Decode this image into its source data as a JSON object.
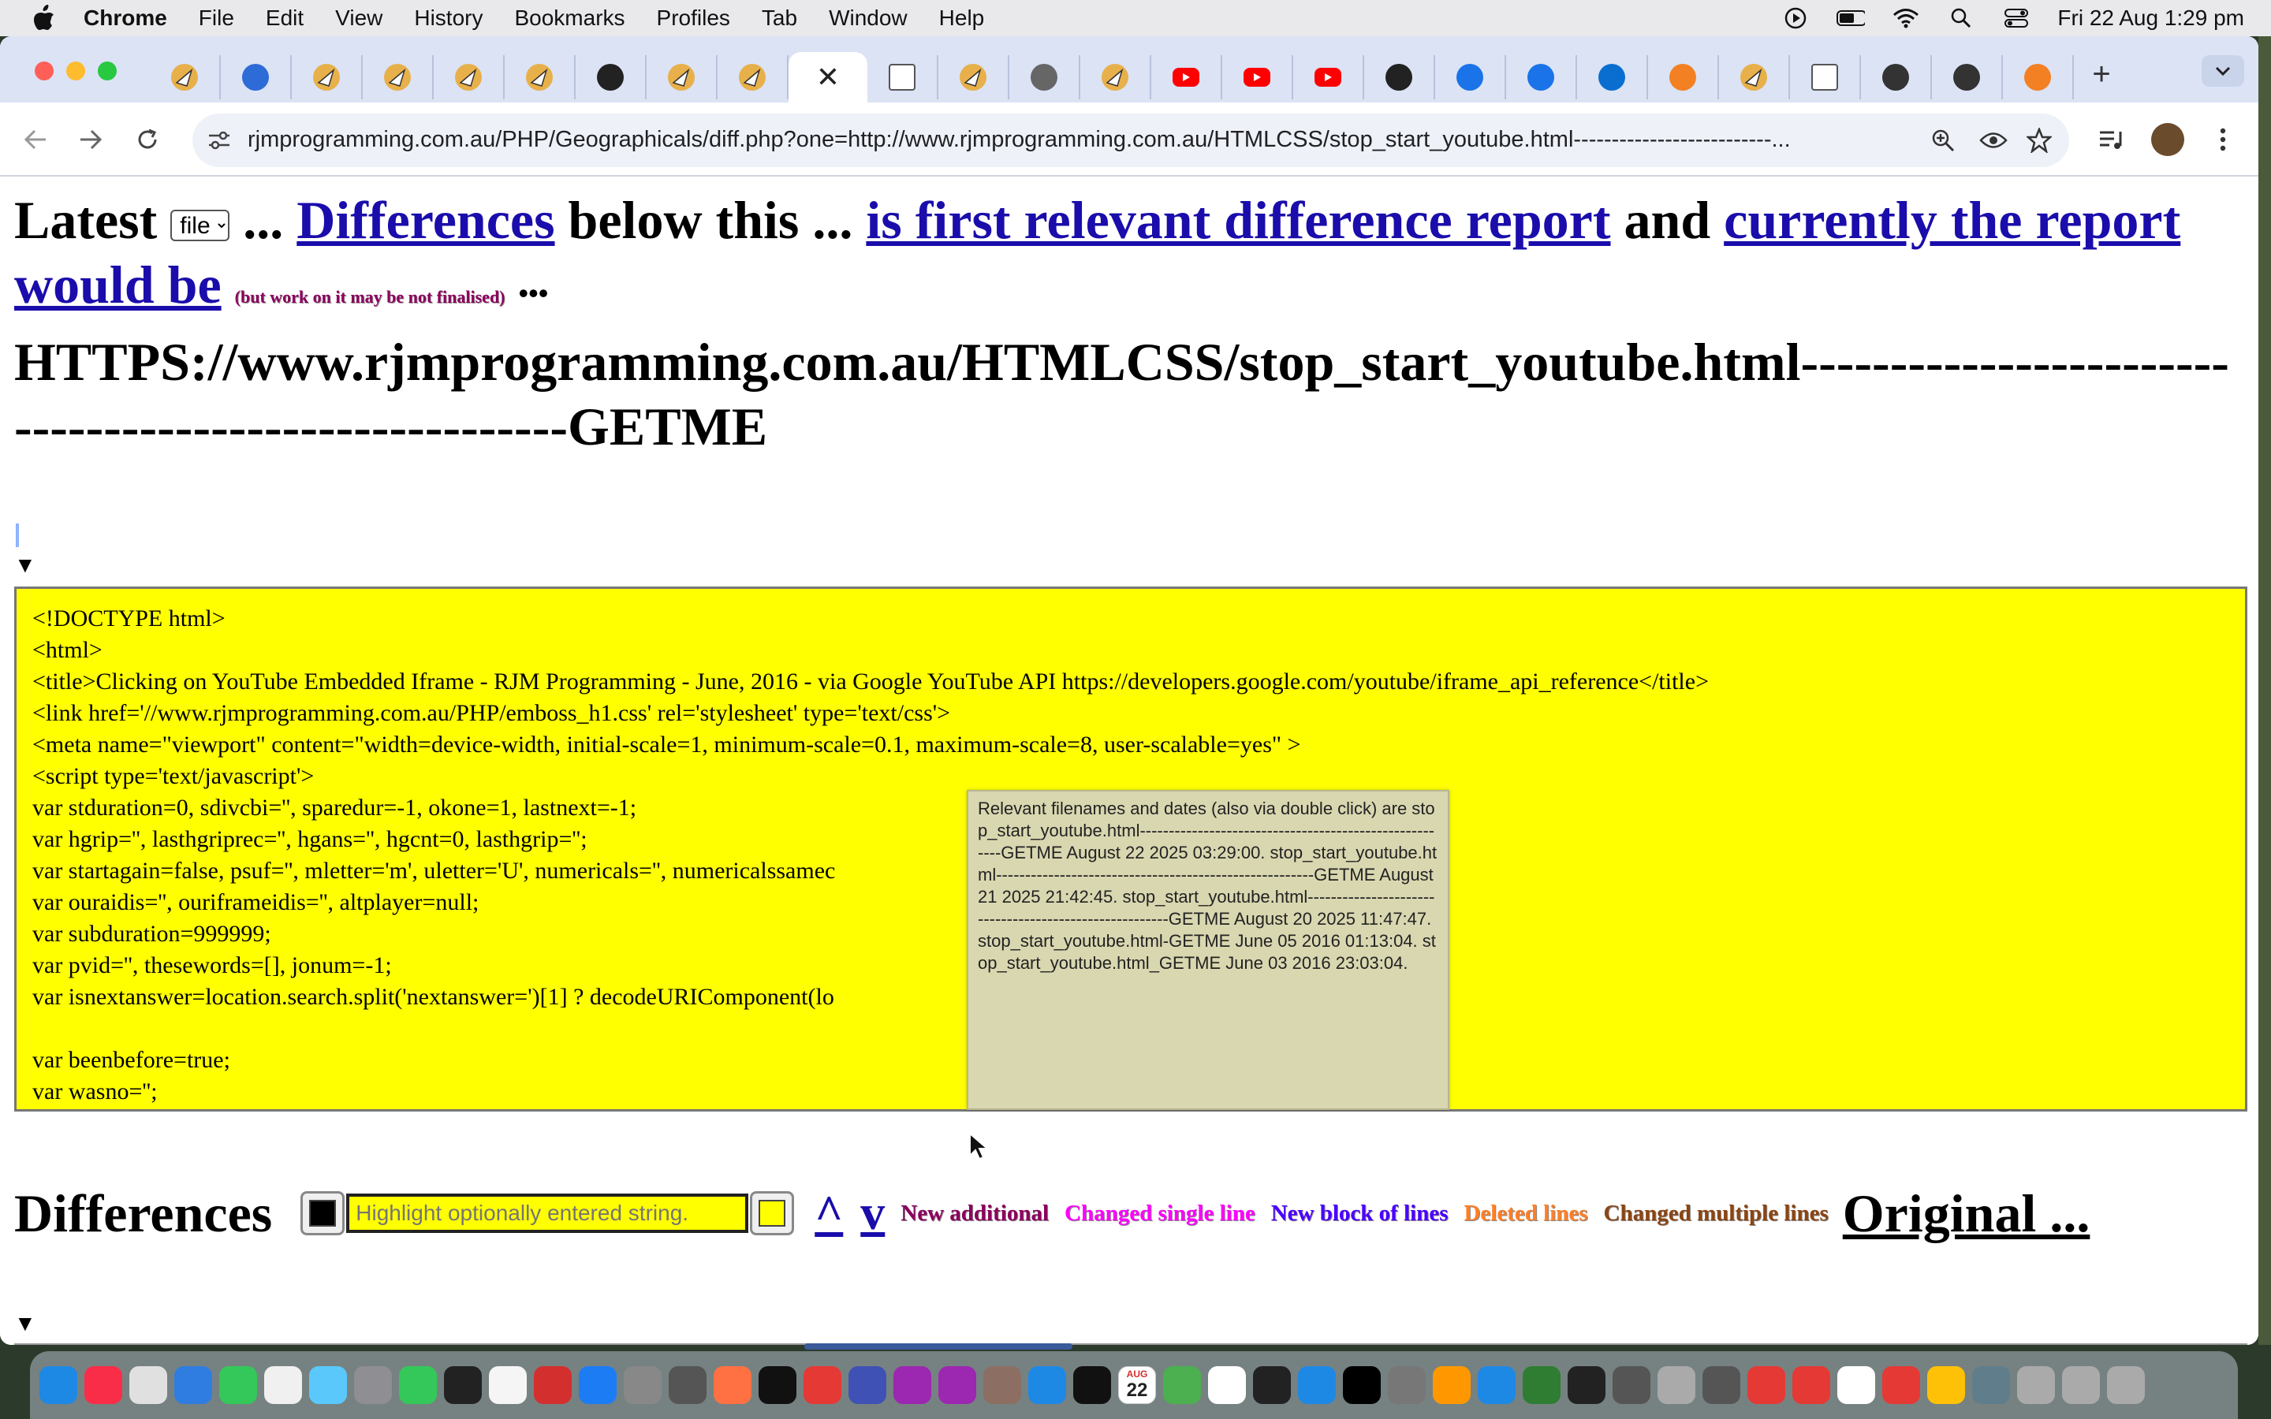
{
  "menubar": {
    "app": "Chrome",
    "items": [
      "File",
      "Edit",
      "View",
      "History",
      "Bookmarks",
      "Profiles",
      "Tab",
      "Window",
      "Help"
    ],
    "clock": "Fri 22 Aug  1:29 pm"
  },
  "tabs": {
    "count_icons": [
      "rjm",
      "check",
      "rjm",
      "rjm",
      "rjm",
      "rjm",
      "circle",
      "rjm",
      "rjm",
      "active",
      "page",
      "rjm",
      "globe",
      "rjm",
      "youtube",
      "youtube",
      "youtube",
      "s",
      "history",
      "gear",
      "sap",
      "stack",
      "rjm",
      "google",
      "github",
      "github",
      "stack"
    ],
    "active_close": "✕",
    "new_tab": "+"
  },
  "address_bar": {
    "url": "rjmprogramming.com.au/PHP/Geographicals/diff.php?one=http://www.rjmprogramming.com.au/HTMLCSS/stop_start_youtube.html--------------------------..."
  },
  "heading": {
    "latest": "Latest",
    "select_value": "file",
    "ellipsis1": "...",
    "differences_link": "Differences",
    "below_this": "below this ...",
    "first_report_link": "is first relevant difference report",
    "and": "and",
    "currently_link": "currently the report would be",
    "small_note": "(but work on it may be not finalised)",
    "dots": "•••",
    "filename": "HTTPS://www.rjmprogramming.com.au/HTMLCSS/stop_start_youtube.html-------------------------------------------------------GETME"
  },
  "code_lines": [
    "<!DOCTYPE html>",
    "<html>",
    "<title>Clicking on YouTube Embedded Iframe - RJM Programming - June, 2016 - via Google YouTube API https://developers.google.com/youtube/iframe_api_reference</title>",
    "<link href='//www.rjmprogramming.com.au/PHP/emboss_h1.css' rel='stylesheet' type='text/css'>",
    "<meta name=\"viewport\" content=\"width=device-width, initial-scale=1, minimum-scale=0.1, maximum-scale=8, user-scalable=yes\" >",
    "<script type='text/javascript'>",
    "var stduration=0, sdivcbi='', sparedur=-1, okone=1, lastnext=-1;",
    "var hgrip='', lasthgriprec='', hgans='', hgcnt=0, lasthgrip='';",
    "var startagain=false, psuf='', mletter='m', uletter='U', numericals='', numericalssamec                                              se, inplaying=false;",
    "var ouraidis='', ouriframeidis='', altplayer=null;",
    "var subduration=999999;",
    "var pvid='', thesewords=[], jonum=-1;",
    "var isnextanswer=location.search.split('nextanswer=')[1] ? decodeURIComponent(lo                                                  &')[0]) : '';",
    "",
    "var beenbefore=true;",
    "var wasno='';"
  ],
  "tooltip": {
    "text": "Relevant filenames and dates (also via double click) are stop_start_youtube.html-------------------------------------------------------GETME August 22 2025 03:29:00. stop_start_youtube.html-------------------------------------------------------GETME August 21 2025 21:42:45. stop_start_youtube.html-------------------------------------------------------GETME August 20 2025 11:47:47. stop_start_youtube.html-GETME June 05 2016 01:13:04. stop_start_youtube.html_GETME June 03 2016 23:03:04."
  },
  "diffbar": {
    "title": "Differences",
    "highlight_placeholder": "Highlight optionally entered string.",
    "up": "^",
    "down": "v",
    "legend": [
      {
        "label": "New additional",
        "color": "#8b005d"
      },
      {
        "label": "Changed single line",
        "color": "#ff00ff"
      },
      {
        "label": "New block of lines",
        "color": "#4b00ff"
      },
      {
        "label": "Deleted lines",
        "color": "#ff7f27"
      },
      {
        "label": "Changed multiple lines",
        "color": "#8b4513"
      }
    ],
    "original": "Original ..."
  },
  "dock": {
    "calendar_day": "22",
    "calendar_month": "AUG"
  }
}
